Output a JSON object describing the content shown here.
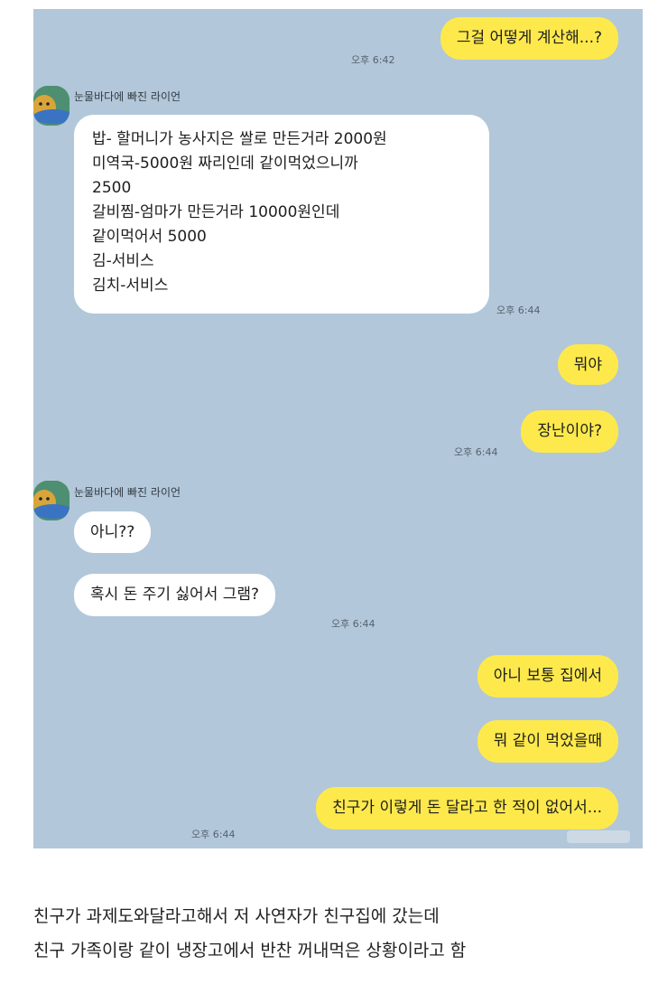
{
  "chat": {
    "sender_name": "눈물바다에 빠진 라이언",
    "messages": [
      {
        "from": "me",
        "text": "그걸 어떻게 계산해...?",
        "time": "오후 6:42"
      },
      {
        "from": "them",
        "text": "밥- 할머니가 농사지은 쌀로 만든거라 2000원\n미역국-5000원 짜리인데 같이먹었으니까\n2500\n갈비찜-엄마가 만든거라 10000원인데\n같이먹어서 5000\n김-서비스\n김치-서비스",
        "time": "오후 6:44"
      },
      {
        "from": "me",
        "text": "뭐야",
        "time": ""
      },
      {
        "from": "me",
        "text": "장난이야?",
        "time": "오후 6:44"
      },
      {
        "from": "them",
        "text": "아니??",
        "time": ""
      },
      {
        "from": "them",
        "text": "혹시 돈 주기 싫어서 그램?",
        "time": "오후 6:44"
      },
      {
        "from": "me",
        "text": "아니 보통 집에서",
        "time": ""
      },
      {
        "from": "me",
        "text": "뭐 같이 먹었을때",
        "time": ""
      },
      {
        "from": "me",
        "text": "친구가 이렇게 돈 달라고 한 적이 없어서...",
        "time": "오후 6:44"
      }
    ]
  },
  "caption": {
    "line1": "친구가 과제도와달라고해서 저 사연자가 친구집에 갔는데",
    "line2": "친구 가족이랑 같이 냉장고에서 반찬 꺼내먹은 상황이라고 함"
  },
  "colors": {
    "chat_bg": "#b2c7d9",
    "my_bubble": "#fde94c",
    "their_bubble": "#ffffff"
  },
  "icons": {
    "avatar": "ryan-avatar-icon"
  }
}
